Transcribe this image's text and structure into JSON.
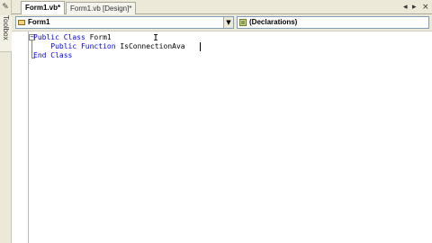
{
  "toolbox": {
    "label": "Toolbox",
    "pin_icon": "pin-icon"
  },
  "tabs": [
    {
      "label": "Form1.vb*",
      "active": true
    },
    {
      "label": "Form1.vb [Design]*",
      "active": false
    }
  ],
  "tab_controls": {
    "scroll_left": "◂",
    "scroll_right": "▸",
    "close": "×"
  },
  "dropdowns": {
    "class_name": {
      "value": "Form1",
      "icon": "class-icon"
    },
    "method_name": {
      "value": "(Declarations)",
      "icon": "declarations-icon"
    }
  },
  "editor": {
    "lines": [
      {
        "keyword": "Public Class",
        "rest": " Form1"
      },
      {
        "indent": "    ",
        "keyword": "Public Function",
        "rest": " IsConnectionAva"
      },
      {
        "keyword": "End Class",
        "rest": ""
      }
    ],
    "collapse_symbol": "−"
  },
  "colors": {
    "keyword": "#0000ff",
    "chrome": "#ece9d8",
    "combo_border": "#7f9db9"
  }
}
